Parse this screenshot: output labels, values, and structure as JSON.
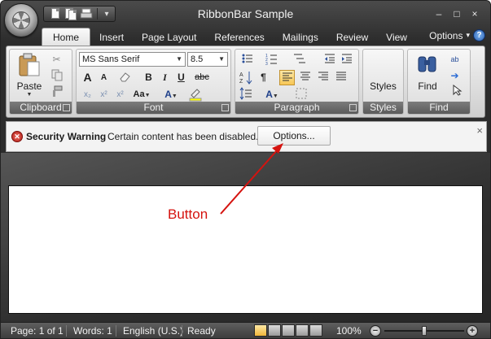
{
  "window": {
    "title": "RibbonBar Sample",
    "controls": {
      "minimize": "–",
      "maximize": "□",
      "close": "×"
    }
  },
  "quick_access": {
    "menu_glyph": "▾"
  },
  "tabs": [
    {
      "label": "Home",
      "active": true
    },
    {
      "label": "Insert"
    },
    {
      "label": "Page Layout"
    },
    {
      "label": "References"
    },
    {
      "label": "Mailings"
    },
    {
      "label": "Review"
    },
    {
      "label": "View"
    }
  ],
  "options_menu": {
    "label": "Options",
    "glyph": "▾",
    "help": "?"
  },
  "ribbon": {
    "clipboard": {
      "caption": "Clipboard",
      "paste": "Paste"
    },
    "font": {
      "caption": "Font",
      "family": "MS Sans Serif",
      "size": "8.5",
      "bold": "B",
      "italic": "I",
      "underline": "U",
      "strike": "abc",
      "grow": "A",
      "shrink": "A",
      "case": "Aa",
      "color_a": "A"
    },
    "paragraph": {
      "caption": "Paragraph",
      "pilcrow": "¶"
    },
    "styles": {
      "caption": "Styles",
      "button": "Styles"
    },
    "find": {
      "caption": "Find",
      "button": "Find"
    }
  },
  "security_bar": {
    "title": "Security Warning",
    "message": "Certain content has been disabled.",
    "button": "Options...",
    "close": "×"
  },
  "annotation": {
    "label": "Button",
    "color": "#d5130f"
  },
  "status": {
    "page": "Page: 1 of 1",
    "words": "Words: 1",
    "language": "English (U.S.)",
    "state": "Ready",
    "zoom": "100%",
    "zoom_level": 0.5
  }
}
